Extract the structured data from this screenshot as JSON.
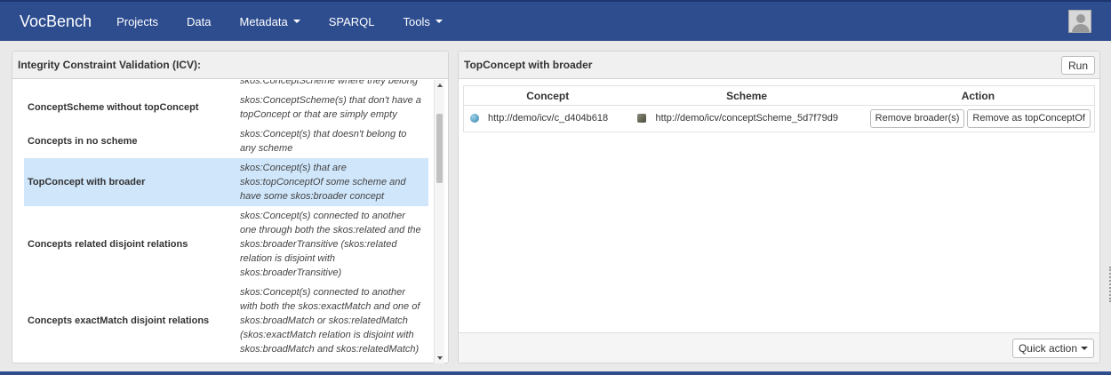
{
  "navbar": {
    "brand": "VocBench",
    "items": [
      {
        "label": "Projects",
        "has_dropdown": false
      },
      {
        "label": "Data",
        "has_dropdown": false
      },
      {
        "label": "Metadata",
        "has_dropdown": true
      },
      {
        "label": "SPARQL",
        "has_dropdown": false
      },
      {
        "label": "Tools",
        "has_dropdown": true
      }
    ],
    "user_icon": "user-avatar-icon"
  },
  "left_panel": {
    "title": "Integrity Constraint Validation (ICV):",
    "rows": [
      {
        "name": "",
        "desc": [
          "skos:ConceptScheme where they belong"
        ]
      },
      {
        "name": "ConceptScheme without topConcept",
        "desc": [
          "skos:ConceptScheme(s) that don't have a",
          "topConcept or that are simply empty"
        ]
      },
      {
        "name": "Concepts in no scheme",
        "desc": [
          "skos:Concept(s) that doesn't belong to",
          "any scheme"
        ]
      },
      {
        "name": "TopConcept with broader",
        "desc": [
          "skos:Concept(s) that are",
          "skos:topConceptOf some scheme and",
          "have some skos:broader concept"
        ],
        "selected": true
      },
      {
        "name": "Concepts related disjoint relations",
        "desc": [
          "skos:Concept(s) connected to another",
          "one through both the skos:related and the",
          "skos:broaderTransitive (skos:related",
          "relation is disjoint with",
          "skos:broaderTransitive)"
        ]
      },
      {
        "name": "Concepts exactMatch disjoint relations",
        "desc": [
          "skos:Concept(s) connected to another",
          "with both the skos:exactMatch and one of",
          "skos:broadMatch or skos:relatedMatch",
          "(skos:exactMatch relation is disjoint with",
          "skos:broadMatch and skos:relatedMatch)"
        ]
      }
    ]
  },
  "right_panel": {
    "title": "TopConcept with broader",
    "run_label": "Run",
    "columns": {
      "concept": "Concept",
      "scheme": "Scheme",
      "action": "Action"
    },
    "results": [
      {
        "concept": "http://demo/icv/c_d404b618",
        "scheme": "http://demo/icv/conceptScheme_5d7f79d9",
        "actions": [
          "Remove broader(s)",
          "Remove as topConceptOf"
        ]
      }
    ],
    "quick_action_label": "Quick action"
  },
  "colors": {
    "navbar": "#2e4d8f",
    "selected_row": "#cfe6fb",
    "concept_icon": "#2f7fa7",
    "scheme_icon": "#5a5a4a"
  }
}
